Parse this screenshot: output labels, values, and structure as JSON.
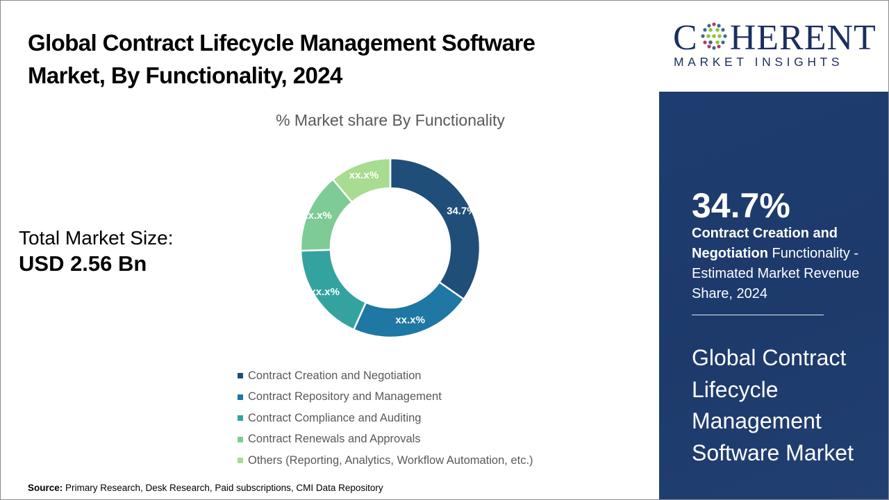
{
  "header": {
    "title_line1": "Global Contract Lifecycle Management Software",
    "title_line2": "Market, By Functionality, 2024"
  },
  "market_size": {
    "label": "Total Market Size:",
    "value": "USD 2.56 Bn"
  },
  "chart_data": {
    "type": "pie",
    "subtype": "donut",
    "title": "% Market share By Functionality",
    "categories": [
      "Contract Creation and Negotiation",
      "Contract Repository and Management",
      "Contract Compliance and Auditing",
      "Contract Renewals and Approvals",
      "Others (Reporting, Analytics, Workflow Automation, etc.)"
    ],
    "values": [
      34.7,
      22.0,
      17.8,
      14.4,
      11.1
    ],
    "data_labels": [
      "34.7%",
      "xx.x%",
      "xx.x%",
      "xx.x%",
      "xx.x%"
    ],
    "colors": [
      "#1f4e79",
      "#1f77a3",
      "#34a3a0",
      "#7ecb95",
      "#a8dc90"
    ],
    "legend_position": "bottom",
    "start_angle_deg": 0,
    "direction": "clockwise"
  },
  "source": {
    "label": "Source:",
    "text": " Primary Research, Desk Research, Paid subscriptions, CMI Data Repository"
  },
  "brand": {
    "name_prefix": "C",
    "name_suffix": "HERENT",
    "tagline": "MARKET INSIGHTS",
    "color": "#1b2f5e"
  },
  "highlight": {
    "percent": "34.7%",
    "segment_bold_line1": "Contract Creation and",
    "segment_bold_line2": "Negotiation",
    "segment_rest": " Functionality - Estimated Market Revenue Share, 2024"
  },
  "sidebar_title": "Global Contract Lifecycle Management Software Market"
}
